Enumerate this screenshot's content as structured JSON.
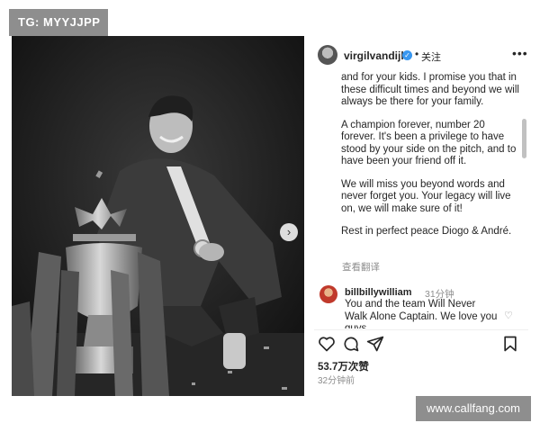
{
  "watermarks": {
    "top": "TG: MYYJJPP",
    "bottom": "www.callfang.com"
  },
  "post": {
    "username": "virgilvandijk",
    "follow_label": "关注",
    "more_icon": "more-horizontal-icon",
    "caption": [
      "and for your kids. I promise you that in these difficult times and beyond we will always be there for your family.",
      "A champion forever, number 20 forever. It's been a privilege to have stood by your side on the pitch, and to have been your friend off it.",
      "We will miss you beyond words and never forget you. Your legacy will live on, we will make sure of it!",
      "Rest in perfect peace Diogo & André."
    ],
    "translate_label": "查看翻译",
    "comment": {
      "username": "billbillywilliam",
      "time": "31分钟",
      "text": "You and the team Will Never Walk Alone Captain. We love you guys"
    },
    "likes": "53.7万次赞",
    "time_ago": "32分钟前",
    "colors": {
      "verified": "#3897f0",
      "text": "#262626",
      "muted": "#8e8e8e"
    }
  }
}
